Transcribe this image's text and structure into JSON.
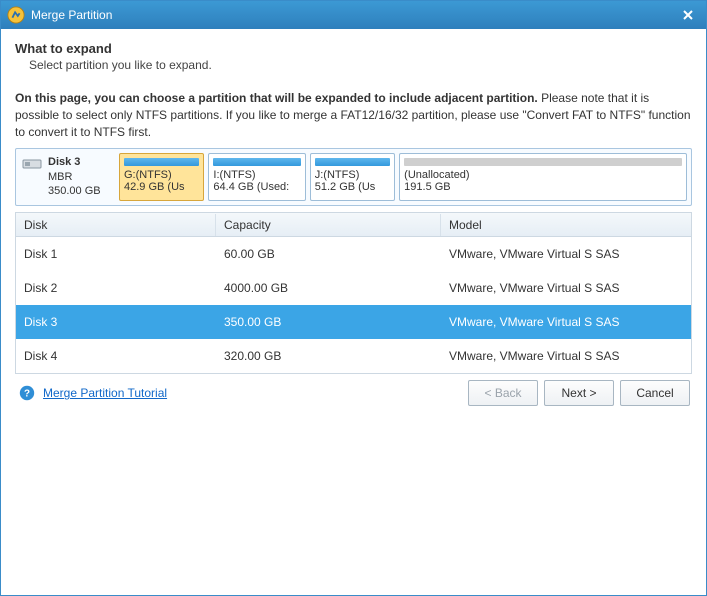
{
  "window": {
    "title": "Merge Partition"
  },
  "header": {
    "heading": "What to expand",
    "subheading": "Select partition you like to expand."
  },
  "description": {
    "bold": "On this page, you can choose a partition that will be expanded to include adjacent partition.",
    "rest": " Please note that it is possible to select only NTFS partitions. If you like to merge a FAT12/16/32 partition, please use \"Convert FAT to NTFS\" function to convert it to NTFS first."
  },
  "disk_panel": {
    "disk_name": "Disk 3",
    "disk_type": "MBR",
    "disk_size": "350.00 GB",
    "selected_index": 0,
    "partitions": [
      {
        "label": "G:(NTFS)",
        "size": "42.9 GB (Us",
        "flex": 0.95,
        "bar": "used"
      },
      {
        "label": "I:(NTFS)",
        "size": "64.4 GB (Used:",
        "flex": 1.1,
        "bar": "used"
      },
      {
        "label": "J:(NTFS)",
        "size": "51.2 GB (Us",
        "flex": 0.95,
        "bar": "used"
      },
      {
        "label": "(Unallocated)",
        "size": "191.5 GB",
        "flex": 3.5,
        "bar": "unused"
      }
    ]
  },
  "table": {
    "columns": {
      "disk": "Disk",
      "capacity": "Capacity",
      "model": "Model"
    },
    "selected_index": 2,
    "rows": [
      {
        "disk": "Disk 1",
        "capacity": "60.00 GB",
        "model": "VMware, VMware Virtual S SAS"
      },
      {
        "disk": "Disk 2",
        "capacity": "4000.00 GB",
        "model": "VMware, VMware Virtual S SAS"
      },
      {
        "disk": "Disk 3",
        "capacity": "350.00 GB",
        "model": "VMware, VMware Virtual S SAS"
      },
      {
        "disk": "Disk 4",
        "capacity": "320.00 GB",
        "model": "VMware, VMware Virtual S SAS"
      }
    ]
  },
  "footer": {
    "tutorial": "Merge Partition Tutorial",
    "back": "< Back",
    "next": "Next >",
    "cancel": "Cancel"
  }
}
